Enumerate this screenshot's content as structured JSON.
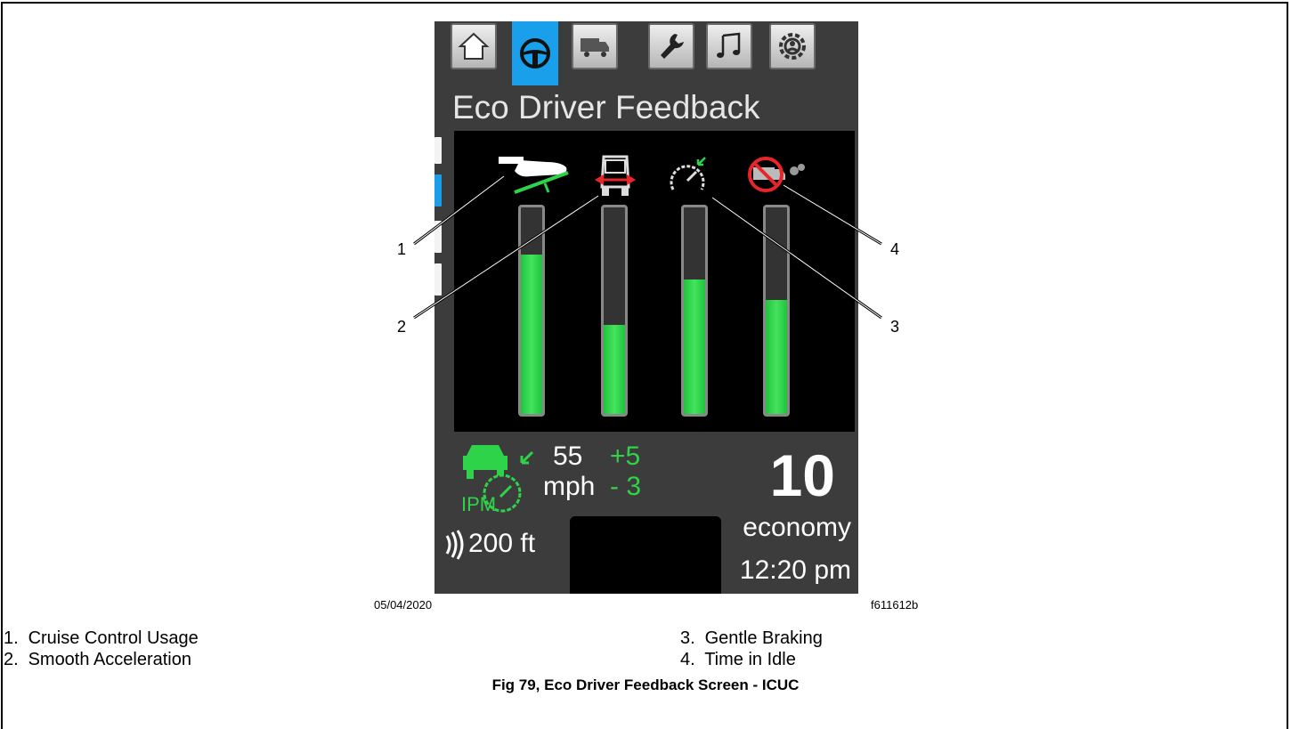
{
  "screen": {
    "title": "Eco Driver Feedback",
    "tabs": [
      {
        "icon": "home-icon",
        "active": false
      },
      {
        "icon": "steering-wheel-icon",
        "active": true
      },
      {
        "icon": "truck-icon",
        "active": false
      },
      {
        "icon": "wrench-icon",
        "active": false
      },
      {
        "icon": "music-note-icon",
        "active": false
      },
      {
        "icon": "settings-gear-icon",
        "active": false
      }
    ],
    "bars": [
      {
        "icon": "cruise-control-foot-pedal-icon",
        "level": 0.77
      },
      {
        "icon": "smooth-acceleration-icon",
        "level": 0.43
      },
      {
        "icon": "gentle-braking-gauge-icon",
        "level": 0.65
      },
      {
        "icon": "time-in-idle-no-truck-icon",
        "level": 0.55
      }
    ],
    "speed_value": "55",
    "speed_unit": "mph",
    "offset_plus": "+5",
    "offset_minus": "- 3",
    "ipm_label": "IPM",
    "following_distance": "200 ft",
    "economy_score": "10",
    "economy_label": "economy",
    "time": "12:20 pm",
    "colors": {
      "accent_blue": "#1aa0ea",
      "bar_green": "#2fd34a",
      "idle_red": "#e8262a"
    }
  },
  "figure": {
    "date": "05/04/2020",
    "figure_id": "f611612b",
    "callouts": [
      "1",
      "2",
      "3",
      "4"
    ],
    "legend": [
      {
        "num": "1.",
        "label": "Cruise Control Usage"
      },
      {
        "num": "2.",
        "label": "Smooth Acceleration"
      },
      {
        "num": "3.",
        "label": "Gentle Braking"
      },
      {
        "num": "4.",
        "label": "Time in Idle"
      }
    ],
    "caption": "Fig 79, Eco Driver Feedback Screen - ICUC"
  }
}
